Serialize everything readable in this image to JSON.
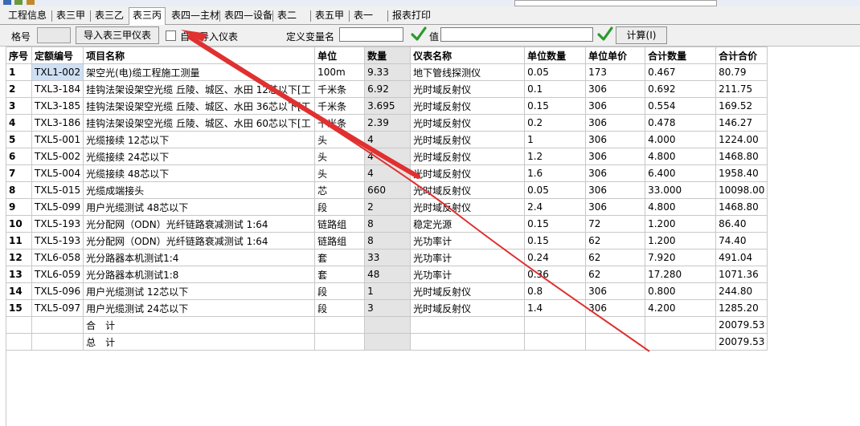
{
  "tabs": [
    {
      "label": "工程信息",
      "active": false
    },
    {
      "label": "表三甲",
      "active": false
    },
    {
      "label": "表三乙",
      "active": false
    },
    {
      "label": "表三丙",
      "active": true
    },
    {
      "label": "表四—主材",
      "active": false
    },
    {
      "label": "表四—设备",
      "active": false
    },
    {
      "label": "表二",
      "active": false
    },
    {
      "label": "表五甲",
      "active": false
    },
    {
      "label": "表一",
      "active": false
    },
    {
      "label": "报表打印",
      "active": false
    }
  ],
  "toolbar": {
    "format_label": "格号",
    "import_button": "导入表三甲仪表",
    "auto_import_label": "自动导入仪表",
    "var_name_label": "定义变量名",
    "value_label": "值",
    "calc_button": "计算(I)"
  },
  "colors": {
    "accent_check": "#2a9a2a",
    "arrow": "#e03030"
  },
  "table": {
    "headers": [
      "序号",
      "定额编号",
      "项目名称",
      "单位",
      "数量",
      "仪表名称",
      "单位数量",
      "单位单价",
      "合计数量",
      "合计合价"
    ],
    "rows": [
      {
        "no": "1",
        "code": "TXL1-002",
        "name": "架空光(电)缆工程施工测量",
        "unit": "100m",
        "qty": "9.33",
        "instrument": "地下管线探测仪",
        "unit_qty": "0.05",
        "unit_price": "173",
        "total_qty": "0.467",
        "total_price": "80.79"
      },
      {
        "no": "2",
        "code": "TXL3-184",
        "name": "挂钩法架设架空光缆 丘陵、城区、水田 12芯以下[工",
        "unit": "千米条",
        "qty": "6.92",
        "instrument": "光时域反射仪",
        "unit_qty": "0.1",
        "unit_price": "306",
        "total_qty": "0.692",
        "total_price": "211.75"
      },
      {
        "no": "3",
        "code": "TXL3-185",
        "name": "挂钩法架设架空光缆 丘陵、城区、水田 36芯以下[工",
        "unit": "千米条",
        "qty": "3.695",
        "instrument": "光时域反射仪",
        "unit_qty": "0.15",
        "unit_price": "306",
        "total_qty": "0.554",
        "total_price": "169.52"
      },
      {
        "no": "4",
        "code": "TXL3-186",
        "name": "挂钩法架设架空光缆 丘陵、城区、水田 60芯以下[工",
        "unit": "千米条",
        "qty": "2.39",
        "instrument": "光时域反射仪",
        "unit_qty": "0.2",
        "unit_price": "306",
        "total_qty": "0.478",
        "total_price": "146.27"
      },
      {
        "no": "5",
        "code": "TXL5-001",
        "name": "光缆接续 12芯以下",
        "unit": "头",
        "qty": "4",
        "instrument": "光时域反射仪",
        "unit_qty": "1",
        "unit_price": "306",
        "total_qty": "4.000",
        "total_price": "1224.00"
      },
      {
        "no": "6",
        "code": "TXL5-002",
        "name": "光缆接续 24芯以下",
        "unit": "头",
        "qty": "4",
        "instrument": "光时域反射仪",
        "unit_qty": "1.2",
        "unit_price": "306",
        "total_qty": "4.800",
        "total_price": "1468.80"
      },
      {
        "no": "7",
        "code": "TXL5-004",
        "name": "光缆接续 48芯以下",
        "unit": "头",
        "qty": "4",
        "instrument": "光时域反射仪",
        "unit_qty": "1.6",
        "unit_price": "306",
        "total_qty": "6.400",
        "total_price": "1958.40"
      },
      {
        "no": "8",
        "code": "TXL5-015",
        "name": "光缆成端接头",
        "unit": "芯",
        "qty": "660",
        "instrument": "光时域反射仪",
        "unit_qty": "0.05",
        "unit_price": "306",
        "total_qty": "33.000",
        "total_price": "10098.00"
      },
      {
        "no": "9",
        "code": "TXL5-099",
        "name": "用户光缆测试 48芯以下",
        "unit": "段",
        "qty": "2",
        "instrument": "光时域反射仪",
        "unit_qty": "2.4",
        "unit_price": "306",
        "total_qty": "4.800",
        "total_price": "1468.80"
      },
      {
        "no": "10",
        "code": "TXL5-193",
        "name": "光分配网（ODN）光纤链路衰减测试 1:64",
        "unit": "链路组",
        "qty": "8",
        "instrument": "稳定光源",
        "unit_qty": "0.15",
        "unit_price": "72",
        "total_qty": "1.200",
        "total_price": "86.40"
      },
      {
        "no": "11",
        "code": "TXL5-193",
        "name": "光分配网（ODN）光纤链路衰减测试 1:64",
        "unit": "链路组",
        "qty": "8",
        "instrument": "光功率计",
        "unit_qty": "0.15",
        "unit_price": "62",
        "total_qty": "1.200",
        "total_price": "74.40"
      },
      {
        "no": "12",
        "code": "TXL6-058",
        "name": "光分路器本机测试1:4",
        "unit": "套",
        "qty": "33",
        "instrument": "光功率计",
        "unit_qty": "0.24",
        "unit_price": "62",
        "total_qty": "7.920",
        "total_price": "491.04"
      },
      {
        "no": "13",
        "code": "TXL6-059",
        "name": "光分路器本机测试1:8",
        "unit": "套",
        "qty": "48",
        "instrument": "光功率计",
        "unit_qty": "0.36",
        "unit_price": "62",
        "total_qty": "17.280",
        "total_price": "1071.36"
      },
      {
        "no": "14",
        "code": "TXL5-096",
        "name": "用户光缆测试 12芯以下",
        "unit": "段",
        "qty": "1",
        "instrument": "光时域反射仪",
        "unit_qty": "0.8",
        "unit_price": "306",
        "total_qty": "0.800",
        "total_price": "244.80"
      },
      {
        "no": "15",
        "code": "TXL5-097",
        "name": "用户光缆测试 24芯以下",
        "unit": "段",
        "qty": "3",
        "instrument": "光时域反射仪",
        "unit_qty": "1.4",
        "unit_price": "306",
        "total_qty": "4.200",
        "total_price": "1285.20"
      }
    ],
    "subtotal": {
      "label": "合　计",
      "total_price": "20079.53"
    },
    "grandtotal": {
      "label": "总　计",
      "total_price": "20079.53"
    }
  }
}
